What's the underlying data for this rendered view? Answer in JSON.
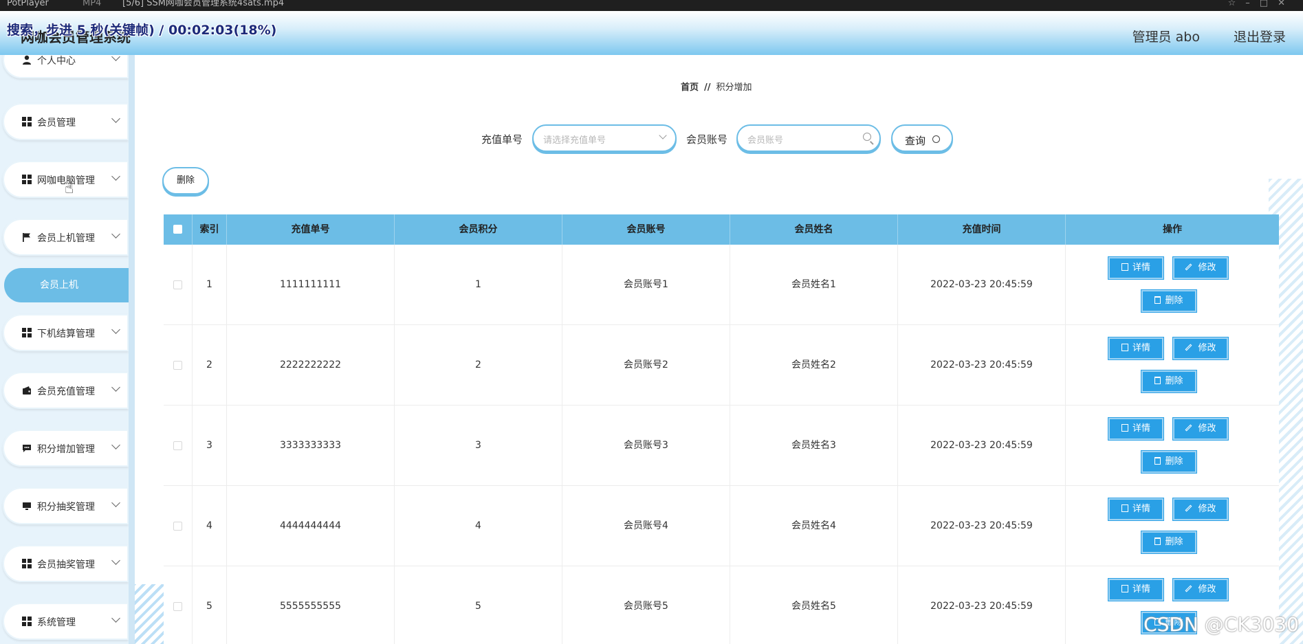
{
  "player": {
    "app": "PotPlayer",
    "format": "MP4",
    "file": "[5/6] SSM网咖会员管理系统4sats.mp4"
  },
  "osd": "搜索，步进 5 秒(关键帧) / 00:02:03(18%)",
  "header": {
    "title": "网咖会员管理系统",
    "admin": "管理员 abo",
    "logout": "退出登录"
  },
  "sidebar": {
    "items": [
      {
        "label": "个人中心",
        "icon": "user-icon"
      },
      {
        "label": "会员管理",
        "icon": "grid-icon"
      },
      {
        "label": "网咖电脑管理",
        "icon": "grid-icon"
      },
      {
        "label": "会员上机管理",
        "icon": "flag-icon"
      },
      {
        "label": "下机结算管理",
        "icon": "grid-icon"
      },
      {
        "label": "会员充值管理",
        "icon": "wallet-icon"
      },
      {
        "label": "积分增加管理",
        "icon": "message-icon"
      },
      {
        "label": "积分抽奖管理",
        "icon": "monitor-icon"
      },
      {
        "label": "会员抽奖管理",
        "icon": "grid-icon"
      },
      {
        "label": "系统管理",
        "icon": "grid-icon"
      }
    ],
    "sub_item": "会员上机"
  },
  "breadcrumb": {
    "home": "首页",
    "separator": "//",
    "current": "积分增加"
  },
  "search": {
    "order_label": "充值单号",
    "order_placeholder": "请选择充值单号",
    "account_label": "会员账号",
    "account_placeholder": "会员账号",
    "query_button": "查询"
  },
  "delete_button": "删除",
  "table": {
    "headers": [
      "索引",
      "充值单号",
      "会员积分",
      "会员账号",
      "会员姓名",
      "充值时间",
      "操作"
    ],
    "rows": [
      {
        "index": "1",
        "order": "1111111111",
        "points": "1",
        "account": "会员账号1",
        "name": "会员姓名1",
        "time": "2022-03-23 20:45:59"
      },
      {
        "index": "2",
        "order": "2222222222",
        "points": "2",
        "account": "会员账号2",
        "name": "会员姓名2",
        "time": "2022-03-23 20:45:59"
      },
      {
        "index": "3",
        "order": "3333333333",
        "points": "3",
        "account": "会员账号3",
        "name": "会员姓名3",
        "time": "2022-03-23 20:45:59"
      },
      {
        "index": "4",
        "order": "4444444444",
        "points": "4",
        "account": "会员账号4",
        "name": "会员姓名4",
        "time": "2022-03-23 20:45:59"
      },
      {
        "index": "5",
        "order": "5555555555",
        "points": "5",
        "account": "会员账号5",
        "name": "会员姓名5",
        "time": "2022-03-23 20:45:59"
      }
    ],
    "actions": {
      "detail": "详情",
      "edit": "修改",
      "delete": "删除"
    }
  },
  "watermark": "CSDN @CK3030",
  "colors": {
    "accent": "#6cbde6",
    "button": "#2aa0e6",
    "header_gradient_end": "#7dc8ef"
  }
}
